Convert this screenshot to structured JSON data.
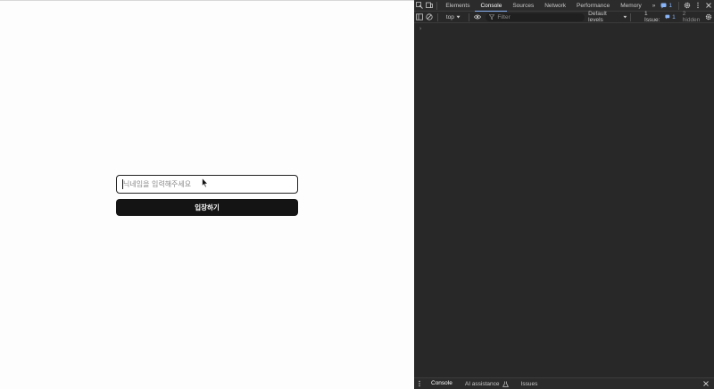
{
  "page": {
    "input_placeholder": "닉네임을 입력해주세요",
    "enter_label": "입장하기"
  },
  "devtools": {
    "tabs": [
      "Elements",
      "Console",
      "Sources",
      "Network",
      "Performance",
      "Memory"
    ],
    "active_tab": "Console",
    "more_tabs": "»",
    "issue_badge": "1",
    "toolbar": {
      "context": "top",
      "filter_placeholder": "Filter",
      "levels": "Default levels",
      "issues_label": "1 Issue:",
      "issues_count": "1",
      "hidden": "2 hidden"
    },
    "console_prompt": "›",
    "drawer_tabs": {
      "console": "Console",
      "ai": "AI assistance",
      "issues": "Issues"
    }
  },
  "colors": {
    "accent": "#8ab4f8",
    "devtools_bg": "#282828",
    "button_bg": "#141414"
  }
}
